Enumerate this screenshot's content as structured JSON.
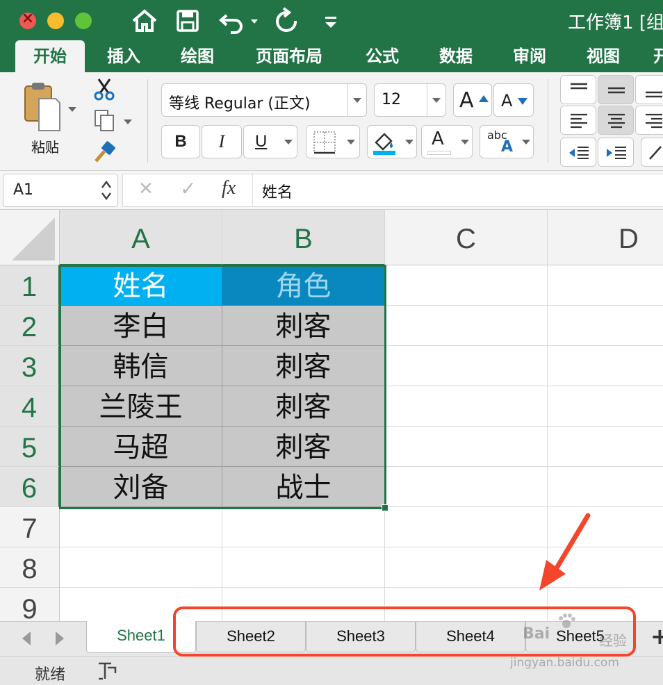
{
  "window": {
    "title": "工作簿1 [组",
    "colors": {
      "accent": "#227447",
      "annotation": "#f4462a",
      "header_a": "#00b0f0",
      "header_b": "#0888bf",
      "data_fill": "#c8c8c8"
    }
  },
  "quick_access": {
    "icons": [
      "home-icon",
      "save-icon",
      "undo-icon",
      "redo-icon",
      "customize-icon"
    ]
  },
  "ribbon_tabs": [
    {
      "label": "开始",
      "active": true
    },
    {
      "label": "插入"
    },
    {
      "label": "绘图"
    },
    {
      "label": "页面布局"
    },
    {
      "label": "公式"
    },
    {
      "label": "数据"
    },
    {
      "label": "审阅"
    },
    {
      "label": "视图"
    },
    {
      "label": "开"
    }
  ],
  "ribbon": {
    "paste_label": "粘贴",
    "font_name": "等线 Regular (正文)",
    "font_size": "12",
    "bold": "B",
    "italic": "I",
    "underline": "U",
    "increase_font": "A",
    "decrease_font": "A",
    "font_color": "A",
    "phonetic_top": "abc",
    "phonetic_bottom": "A"
  },
  "formula_bar": {
    "name_box": "A1",
    "cancel": "✕",
    "enter": "✓",
    "fx": "fx",
    "content": "姓名"
  },
  "grid": {
    "columns": [
      "A",
      "B",
      "C",
      "D"
    ],
    "rows": [
      "1",
      "2",
      "3",
      "4",
      "5",
      "6",
      "7",
      "8",
      "9"
    ],
    "table": [
      [
        "姓名",
        "角色"
      ],
      [
        "李白",
        "刺客"
      ],
      [
        "韩信",
        "刺客"
      ],
      [
        "兰陵王",
        "刺客"
      ],
      [
        "马超",
        "刺客"
      ],
      [
        "刘备",
        "战士"
      ]
    ]
  },
  "sheets": [
    {
      "label": "Sheet1",
      "active": true
    },
    {
      "label": "Sheet2"
    },
    {
      "label": "Sheet3"
    },
    {
      "label": "Sheet4"
    },
    {
      "label": "Sheet5"
    }
  ],
  "add_sheet": "+",
  "status": {
    "text": "就绪"
  },
  "watermark": {
    "line1": "Bai",
    "line2": "经验",
    "line3": "jingyan.baidu.com"
  }
}
